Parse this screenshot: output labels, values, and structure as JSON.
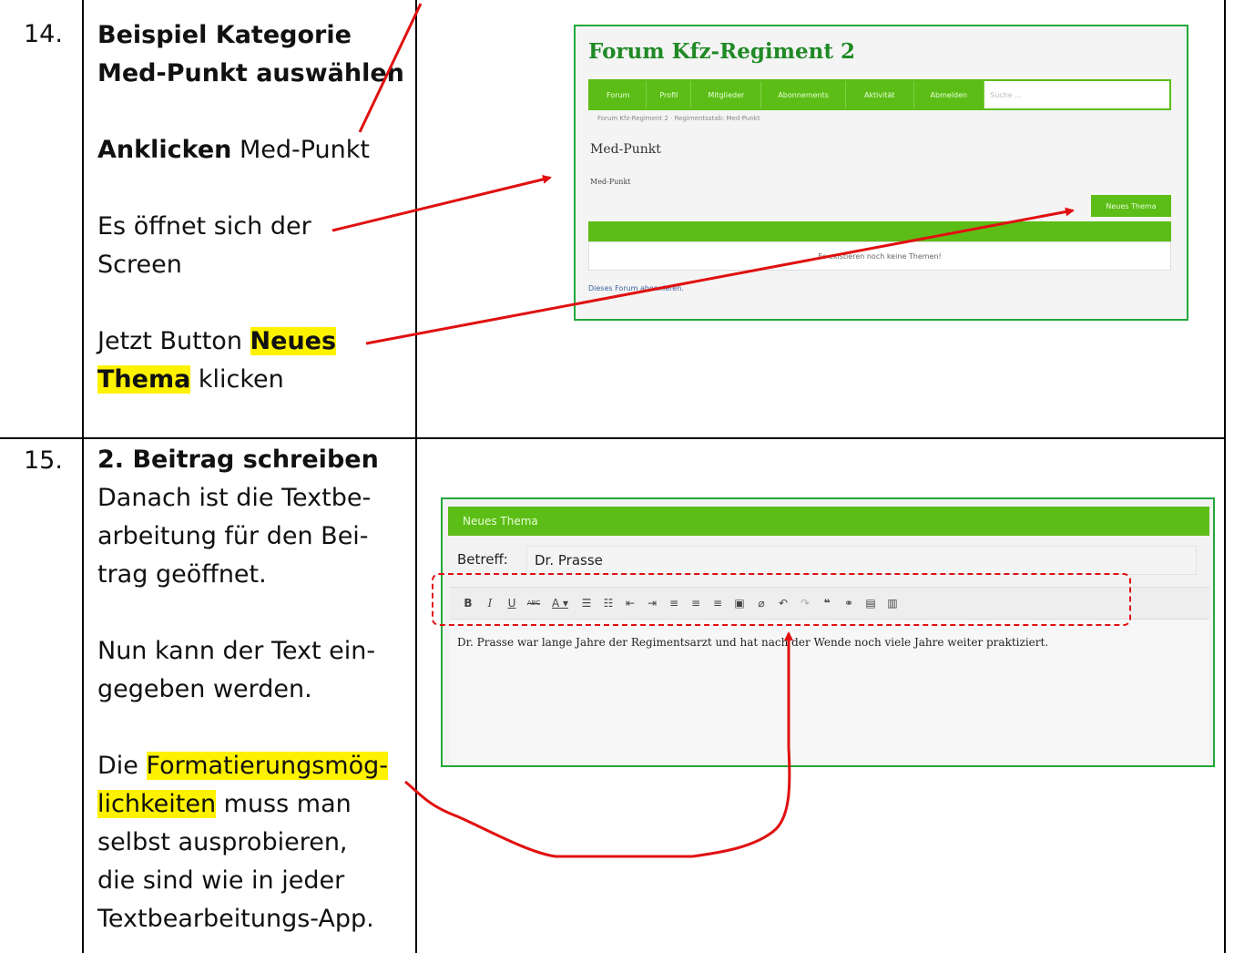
{
  "rows": [
    {
      "number": "14.",
      "heading_line1": "Beispiel Kategorie",
      "heading_line2": "Med-Punkt auswählen",
      "click_bold": "Anklicken",
      "click_rest": " Med-Punkt",
      "opens_line1": "Es öffnet sich der",
      "opens_line2": "Screen",
      "button_pre": "Jetzt Button ",
      "button_hl1": "Neues",
      "button_hl2": "Thema",
      "button_post": " klicken"
    },
    {
      "number": "15.",
      "heading": "2. Beitrag schreiben",
      "desc_lines": [
        "Danach ist die Textbe-",
        "arbeitung für den Bei-",
        "trag geöffnet."
      ],
      "enter_lines": [
        "Nun kann der Text ein-",
        "gegeben werden."
      ],
      "format_pre": "Die ",
      "format_hl1": "Formatierungsmög-",
      "format_hl2": "lichkeiten",
      "format_post": " muss man",
      "format_rest": [
        "selbst ausprobieren,",
        "die sind wie in jeder",
        "Textbearbeitungs-App."
      ]
    }
  ],
  "forum_screenshot": {
    "site_title": "Forum Kfz-Regiment 2",
    "nav_items": [
      "Forum",
      "Profil",
      "Mitglieder",
      "Abonnements",
      "Aktivität",
      "Abmelden"
    ],
    "search_placeholder": "Suche ...",
    "breadcrumb": "Forum Kfz-Regiment 2 · Regimentsstab: Med-Punkt",
    "page_title": "Med-Punkt",
    "page_description": "Med-Punkt",
    "new_topic_button": "Neues Thema",
    "empty_message": "Es existieren noch keine Themen!",
    "subscribe_link": "Dieses Forum abonnieren."
  },
  "editor_screenshot": {
    "header": "Neues Thema",
    "subject_label": "Betreff:",
    "subject_value": "Dr. Prasse",
    "toolbar_icons": [
      "bold-icon",
      "italic-icon",
      "underline-icon",
      "strikethrough-icon",
      "text-color-icon",
      "bullet-list-icon",
      "numbered-list-icon",
      "outdent-icon",
      "indent-icon",
      "align-left-icon",
      "align-center-icon",
      "align-right-icon",
      "paste-icon",
      "eraser-icon",
      "undo-icon",
      "redo-icon",
      "quote-icon",
      "link-icon",
      "image-icon",
      "fullscreen-icon"
    ],
    "body_text": "Dr. Prasse war lange Jahre der Regimentsarzt und hat nach der Wende noch viele Jahre weiter praktiziert."
  },
  "colors": {
    "accent_green": "#5cbd16",
    "frame_green": "#22a83a",
    "arrow_red": "#e01010",
    "highlight_yellow": "#fff200"
  }
}
